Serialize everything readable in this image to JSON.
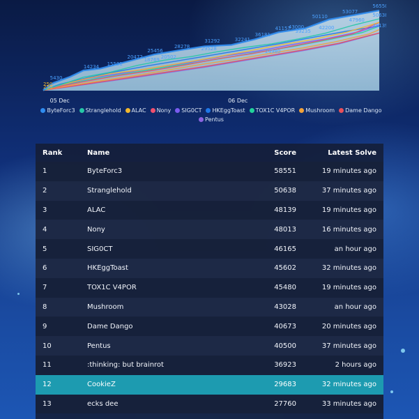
{
  "chart_data": {
    "type": "line",
    "x_ticks": [
      "05 Dec",
      "06 Dec"
    ],
    "y_ticks": [],
    "series": [
      {
        "name": "ByteForc3",
        "color": "#2f8cf0",
        "x": [
          0,
          0.03,
          0.08,
          0.12,
          0.17,
          0.25,
          0.33,
          0.4,
          0.48,
          0.56,
          0.63,
          0.7,
          0.78,
          0.85,
          0.92,
          1.0
        ],
        "values": [
          250,
          5430,
          9800,
          14234,
          15591,
          20472,
          25456,
          28278,
          31292,
          32241,
          36181,
          41157,
          44000,
          50110,
          53077,
          56550
        ]
      },
      {
        "name": "Stranglehold",
        "color": "#26c7a6",
        "x": [
          0,
          0.05,
          0.12,
          0.2,
          0.28,
          0.36,
          0.44,
          0.52,
          0.6,
          0.68,
          0.76,
          0.84,
          0.92,
          1.0
        ],
        "values": [
          250,
          4000,
          9500,
          13000,
          17800,
          21500,
          24000,
          27500,
          30500,
          33000,
          36500,
          40500,
          46000,
          50638
        ]
      },
      {
        "name": "ALAC",
        "color": "#f2b82e",
        "x": [
          0,
          0.05,
          0.12,
          0.2,
          0.3,
          0.4,
          0.5,
          0.6,
          0.7,
          0.8,
          0.9,
          1.0
        ],
        "values": [
          250,
          3800,
          8000,
          12000,
          15000,
          19000,
          23000,
          27500,
          32000,
          36000,
          41000,
          48139
        ]
      },
      {
        "name": "Nony",
        "color": "#f0506e",
        "x": [
          0,
          0.06,
          0.14,
          0.22,
          0.32,
          0.42,
          0.52,
          0.62,
          0.72,
          0.82,
          0.92,
          1.0
        ],
        "values": [
          250,
          3500,
          7200,
          10500,
          14000,
          18000,
          22500,
          26000,
          30500,
          35000,
          40000,
          48013
        ]
      },
      {
        "name": "SIG0CT",
        "color": "#7a5cf0",
        "x": [
          0,
          0.06,
          0.14,
          0.24,
          0.34,
          0.44,
          0.54,
          0.64,
          0.74,
          0.84,
          0.94,
          1.0
        ],
        "values": [
          250,
          4200,
          8800,
          12500,
          16500,
          20000,
          24500,
          28000,
          32500,
          36500,
          41500,
          46165
        ]
      },
      {
        "name": "HKEggToast",
        "color": "#1f78e8",
        "x": [
          0,
          0.05,
          0.13,
          0.22,
          0.31,
          0.4,
          0.5,
          0.6,
          0.7,
          0.8,
          0.9,
          1.0
        ],
        "values": [
          250,
          4500,
          9000,
          13500,
          17500,
          21000,
          25000,
          29000,
          33000,
          37500,
          41800,
          45602
        ]
      },
      {
        "name": "TOX1C V4POR",
        "color": "#22d39a",
        "x": [
          0,
          0.06,
          0.15,
          0.25,
          0.35,
          0.45,
          0.55,
          0.65,
          0.75,
          0.85,
          0.95,
          1.0
        ],
        "values": [
          250,
          3900,
          8200,
          12000,
          16000,
          19500,
          23500,
          27500,
          31500,
          36000,
          41000,
          45480
        ]
      },
      {
        "name": "Mushroom",
        "color": "#f2a23a",
        "x": [
          0,
          0.07,
          0.17,
          0.27,
          0.37,
          0.47,
          0.57,
          0.67,
          0.77,
          0.87,
          0.97,
          1.0
        ],
        "values": [
          250,
          3200,
          7000,
          10500,
          14500,
          18500,
          22000,
          26000,
          30000,
          34500,
          40000,
          43028
        ]
      },
      {
        "name": "Dame Dango",
        "color": "#e8505a",
        "x": [
          0,
          0.08,
          0.18,
          0.28,
          0.38,
          0.48,
          0.58,
          0.68,
          0.78,
          0.88,
          1.0
        ],
        "values": [
          250,
          3000,
          6500,
          10000,
          13500,
          17000,
          21000,
          24980,
          29000,
          33500,
          40673
        ]
      },
      {
        "name": "Pentus",
        "color": "#8a64e0",
        "x": [
          0,
          0.08,
          0.18,
          0.28,
          0.38,
          0.48,
          0.58,
          0.68,
          0.78,
          0.88,
          1.0
        ],
        "values": [
          250,
          2800,
          6200,
          9500,
          13000,
          16500,
          20500,
          24500,
          28500,
          33000,
          40500
        ]
      }
    ],
    "data_labels": [
      "250",
      "250",
      "5430",
      "14234",
      "15591",
      "20472",
      "18769",
      "20502",
      "25456",
      "28278",
      "29528",
      "31292",
      "32241",
      "36181",
      "41157",
      "43000",
      "39235",
      "50110",
      "42200",
      "53077",
      "47960",
      "56550",
      "50638",
      "48139",
      "24980"
    ]
  },
  "legend": [
    {
      "label": "ByteForc3",
      "color": "#2f8cf0"
    },
    {
      "label": "Stranglehold",
      "color": "#26c7a6"
    },
    {
      "label": "ALAC",
      "color": "#f2b82e"
    },
    {
      "label": "Nony",
      "color": "#f0506e"
    },
    {
      "label": "SIG0CT",
      "color": "#7a5cf0"
    },
    {
      "label": "HKEggToast",
      "color": "#1f78e8"
    },
    {
      "label": "TOX1C V4POR",
      "color": "#22d39a"
    },
    {
      "label": "Mushroom",
      "color": "#f2a23a"
    },
    {
      "label": "Dame Dango",
      "color": "#e8505a"
    },
    {
      "label": "Pentus",
      "color": "#8a64e0"
    }
  ],
  "table": {
    "headers": {
      "rank": "Rank",
      "name": "Name",
      "score": "Score",
      "latest": "Latest Solve"
    },
    "highlight_color": "#1d9bb0",
    "rows": [
      {
        "rank": "1",
        "name": "ByteForc3",
        "score": "58551",
        "latest": "19 minutes ago"
      },
      {
        "rank": "2",
        "name": "Stranglehold",
        "score": "50638",
        "latest": "37 minutes ago"
      },
      {
        "rank": "3",
        "name": "ALAC",
        "score": "48139",
        "latest": "19 minutes ago"
      },
      {
        "rank": "4",
        "name": "Nony",
        "score": "48013",
        "latest": "16 minutes ago"
      },
      {
        "rank": "5",
        "name": "SIG0CT",
        "score": "46165",
        "latest": "an hour ago"
      },
      {
        "rank": "6",
        "name": "HKEggToast",
        "score": "45602",
        "latest": "32 minutes ago"
      },
      {
        "rank": "7",
        "name": "TOX1C V4POR",
        "score": "45480",
        "latest": "19 minutes ago"
      },
      {
        "rank": "8",
        "name": "Mushroom",
        "score": "43028",
        "latest": "an hour ago"
      },
      {
        "rank": "9",
        "name": "Dame Dango",
        "score": "40673",
        "latest": "20 minutes ago"
      },
      {
        "rank": "10",
        "name": "Pentus",
        "score": "40500",
        "latest": "37 minutes ago"
      },
      {
        "rank": "11",
        "name": ":thinking: but brainrot",
        "score": "36923",
        "latest": "2 hours ago"
      },
      {
        "rank": "12",
        "name": "CookieZ",
        "score": "29683",
        "latest": "32 minutes ago",
        "highlighted": true
      },
      {
        "rank": "13",
        "name": "ecks dee",
        "score": "27760",
        "latest": "33 minutes ago"
      }
    ]
  }
}
